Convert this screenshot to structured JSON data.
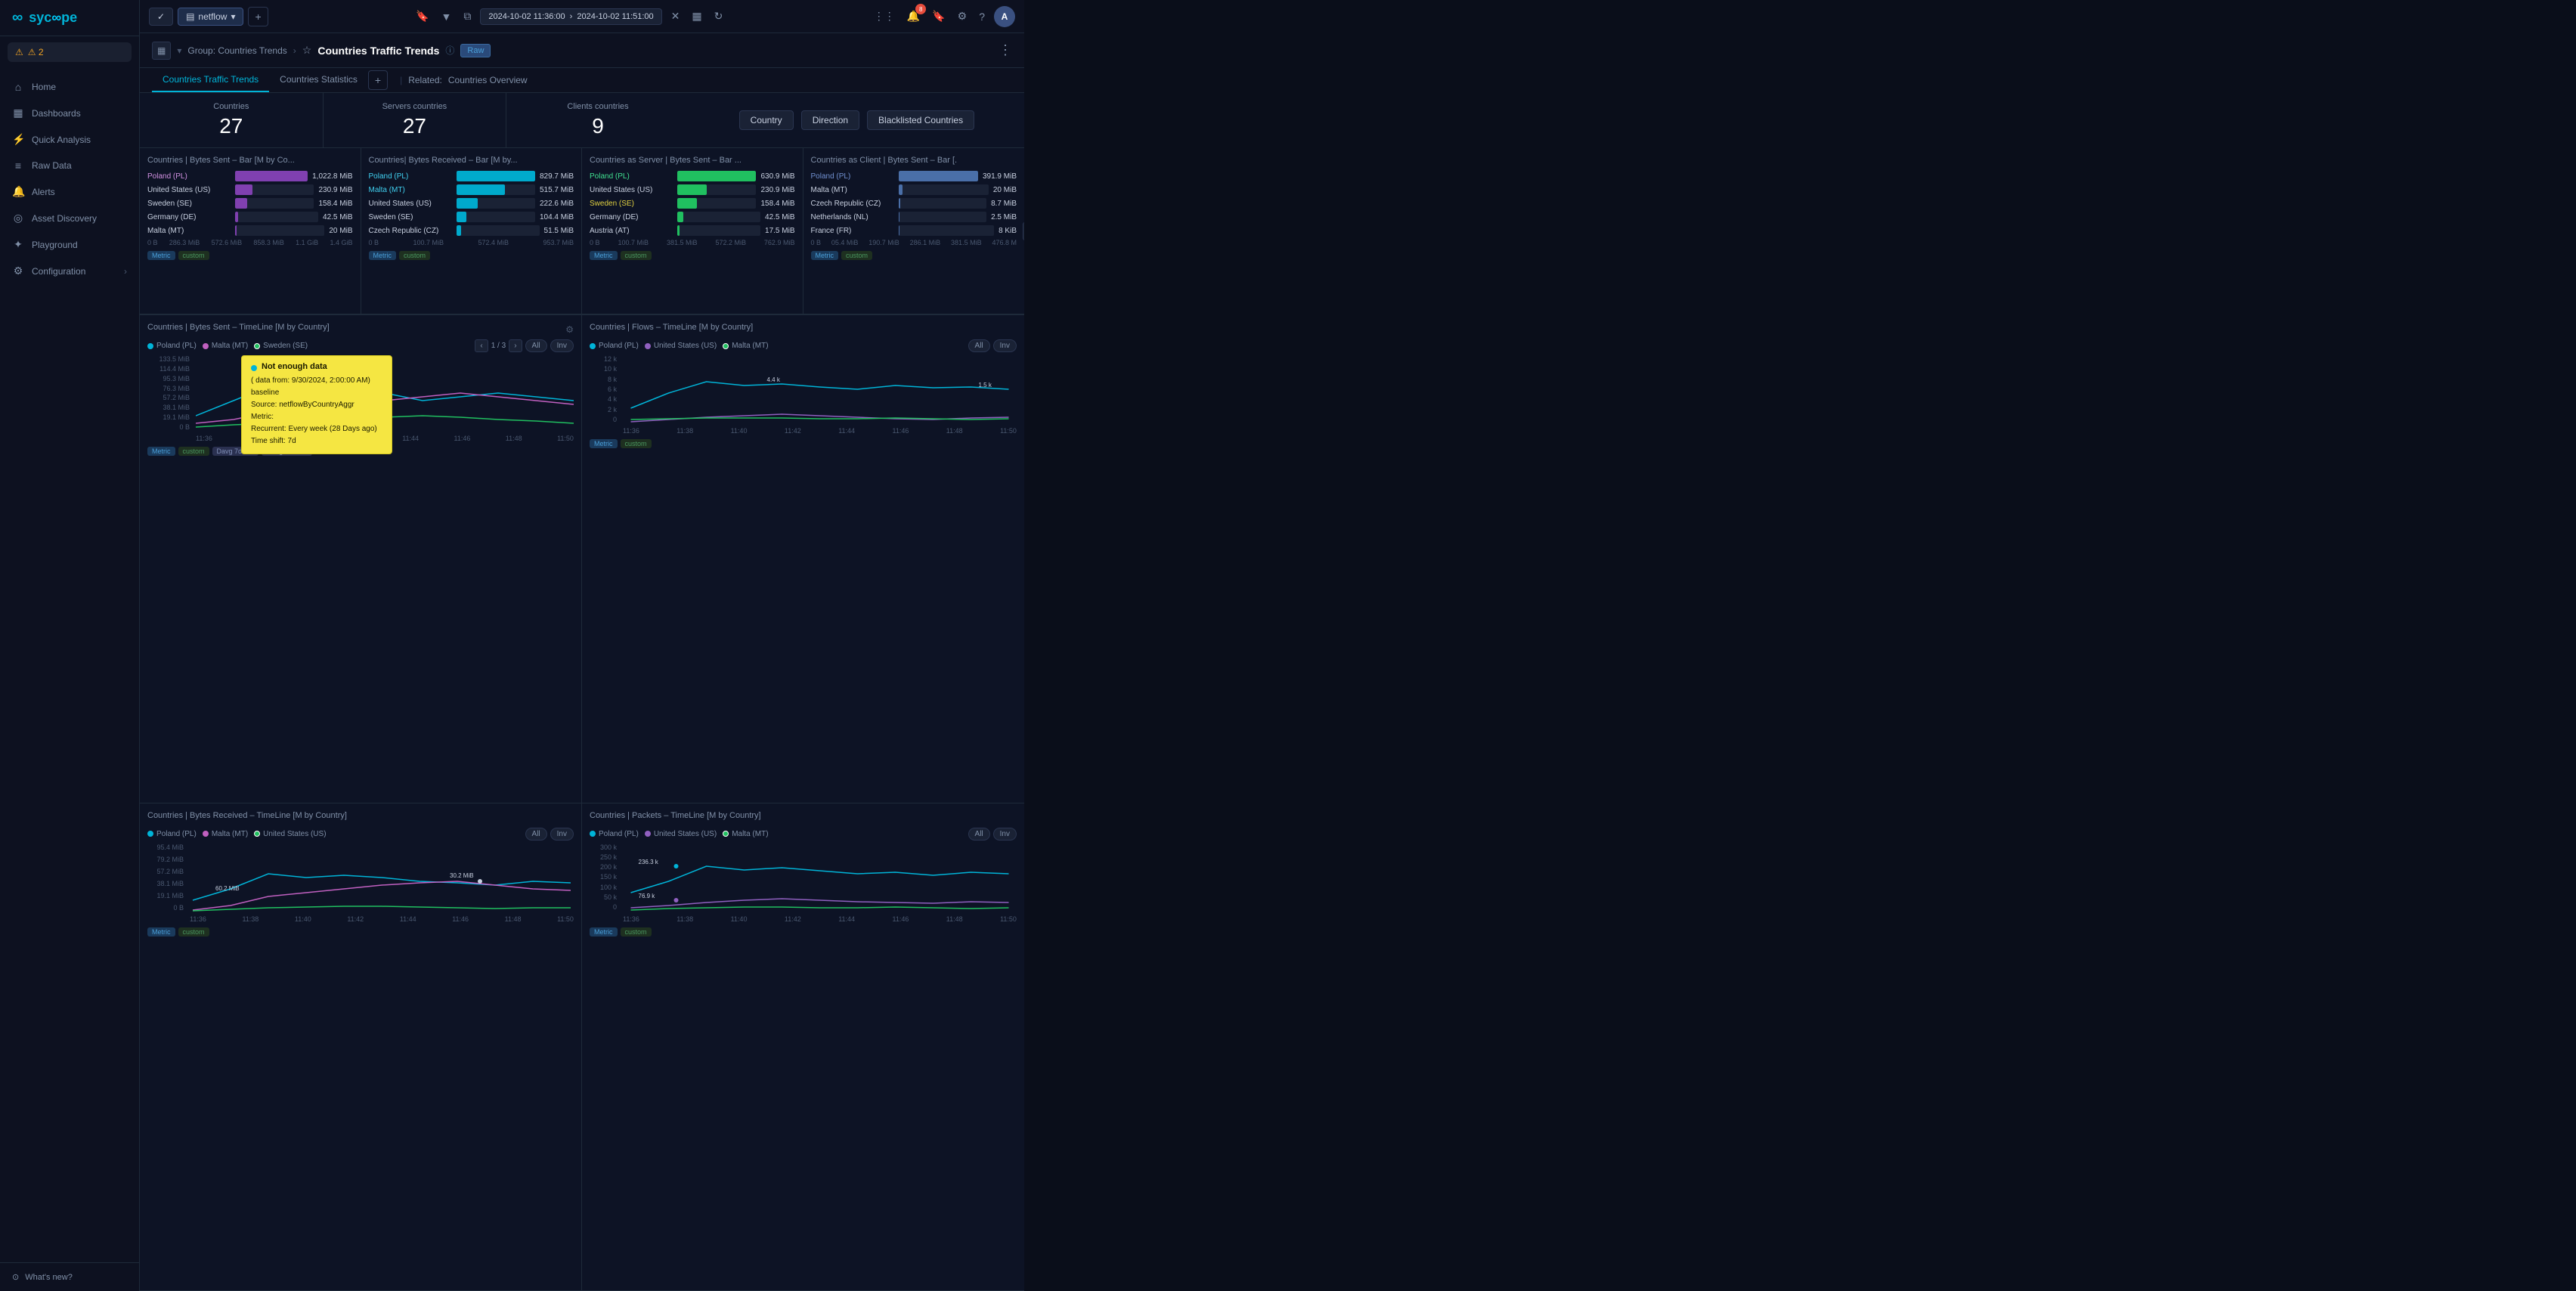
{
  "sidebar": {
    "logo": "syc∞pe",
    "alert": "⚠ 2",
    "items": [
      {
        "id": "home",
        "icon": "⌂",
        "label": "Home",
        "active": false
      },
      {
        "id": "dashboards",
        "icon": "▦",
        "label": "Dashboards",
        "active": false
      },
      {
        "id": "quick-analysis",
        "icon": "⚡",
        "label": "Quick Analysis",
        "active": false
      },
      {
        "id": "raw-data",
        "icon": "≡",
        "label": "Raw Data",
        "active": false
      },
      {
        "id": "alerts",
        "icon": "🔔",
        "label": "Alerts",
        "active": false
      },
      {
        "id": "asset-discovery",
        "icon": "◎",
        "label": "Asset Discovery",
        "active": false
      },
      {
        "id": "playground",
        "icon": "✦",
        "label": "Playground",
        "active": false
      },
      {
        "id": "configuration",
        "icon": "⚙",
        "label": "Configuration",
        "active": false
      }
    ],
    "whats_new": "What's new?"
  },
  "topbar": {
    "tab_label": "netflow",
    "add_tab": "+",
    "time_start": "2024-10-02 11:36:00",
    "time_end": "2024-10-02 11:51:00",
    "notification_count": "8"
  },
  "page_header": {
    "breadcrumb_group": "Group: Countries Trends",
    "page_title": "Countries Traffic Trends",
    "raw_badge": "Raw",
    "related_label": "Related:",
    "related_link": "Countries Overview",
    "tabs": [
      {
        "id": "traffic-trends",
        "label": "Countries Traffic Trends",
        "active": true
      },
      {
        "id": "statistics",
        "label": "Countries Statistics",
        "active": false
      }
    ]
  },
  "stats": {
    "countries": {
      "label": "Countries",
      "value": "27"
    },
    "servers_countries": {
      "label": "Servers countries",
      "value": "27"
    },
    "clients_countries": {
      "label": "Clients countries",
      "value": "9"
    },
    "filters": {
      "country": "Country",
      "direction": "Direction",
      "blacklisted": "Blacklisted Countries"
    }
  },
  "bar_charts": [
    {
      "id": "bytes-sent",
      "title": "Countries | Bytes Sent – Bar [M by Co...",
      "items": [
        {
          "label": "Poland (PL)",
          "value": "1,022.8 MiB",
          "pct": 100,
          "color": "#7c3fa0"
        },
        {
          "label": "United States (US)",
          "value": "230.9 MiB",
          "pct": 22,
          "color": "#7c3fa0"
        },
        {
          "label": "Sweden (SE)",
          "value": "158.4 MiB",
          "pct": 15,
          "color": "#7c3fa0"
        },
        {
          "label": "Germany (DE)",
          "value": "42.5 MiB",
          "pct": 4,
          "color": "#7c3fa0"
        },
        {
          "label": "Malta (MT)",
          "value": "20 MiB",
          "pct": 2,
          "color": "#7c3fa0"
        }
      ],
      "axis": [
        "0 B",
        "286.3 MiB",
        "572.6 MiB",
        "858.3 MiB",
        "1.1 GiB",
        "1.4 GiB"
      ]
    },
    {
      "id": "bytes-received",
      "title": "Countries| Bytes Received – Bar [M by...",
      "items": [
        {
          "label": "Poland (PL)",
          "value": "829.7 MiB",
          "pct": 100,
          "color": "#00aacc"
        },
        {
          "label": "Malta (MT)",
          "value": "515.7 MiB",
          "pct": 62,
          "color": "#00aacc"
        },
        {
          "label": "United States (US)",
          "value": "222.6 MiB",
          "pct": 27,
          "color": "#00aacc"
        },
        {
          "label": "Sweden (SE)",
          "value": "104.4 MiB",
          "pct": 13,
          "color": "#00aacc"
        },
        {
          "label": "Czech Republic (CZ)",
          "value": "51.5 MiB",
          "pct": 6,
          "color": "#00aacc"
        }
      ],
      "axis": [
        "0 B",
        "100.7 MiB",
        "572.4 MiB",
        "953.7 MiB"
      ]
    },
    {
      "id": "as-server-bytes-sent",
      "title": "Countries as Server | Bytes Sent – Bar ...",
      "items": [
        {
          "label": "Poland (PL)",
          "value": "630.9 MiB",
          "pct": 100,
          "color": "#20c060"
        },
        {
          "label": "United States (US)",
          "value": "230.9 MiB",
          "pct": 37,
          "color": "#20c060"
        },
        {
          "label": "Sweden (SE)",
          "value": "158.4 MiB",
          "pct": 25,
          "color": "#20c060"
        },
        {
          "label": "Germany (DE)",
          "value": "42.5 MiB",
          "pct": 7,
          "color": "#20c060"
        },
        {
          "label": "Austria (AT)",
          "value": "17.5 MiB",
          "pct": 3,
          "color": "#20c060"
        }
      ],
      "axis": [
        "0 B",
        "100.7 MiB",
        "381.5 MiB",
        "572.2 MiB",
        "762.9 MiB"
      ]
    },
    {
      "id": "as-client-bytes-sent",
      "title": "Countries as Client | Bytes Sent – Bar [.",
      "items": [
        {
          "label": "Poland (PL)",
          "value": "391.9 MiB",
          "pct": 100,
          "color": "#4a6fa8"
        },
        {
          "label": "Malta (MT)",
          "value": "20 MiB",
          "pct": 5,
          "color": "#4a6fa8"
        },
        {
          "label": "Czech Republic (CZ)",
          "value": "8.7 MiB",
          "pct": 2,
          "color": "#4a6fa8"
        },
        {
          "label": "Netherlands (NL)",
          "value": "2.5 MiB",
          "pct": 1,
          "color": "#4a6fa8"
        },
        {
          "label": "France (FR)",
          "value": "8 KiB",
          "pct": 0.1,
          "color": "#4a6fa8"
        }
      ],
      "axis": [
        "0 B",
        "05.4 MiB",
        "190.7 MiB",
        "286.1 MiB",
        "381.5 MiB",
        "476.8 M"
      ]
    }
  ],
  "timeline_charts": [
    {
      "id": "bytes-sent-timeline",
      "title": "Countries | Bytes Sent – TimeLine [M by Country]",
      "legends": [
        {
          "color": "#00b4d8",
          "label": "Poland (PL)"
        },
        {
          "color": "#c060c0",
          "label": "Malta (MT)"
        },
        {
          "color": "#20c060",
          "label": "Sweden (SE)"
        }
      ],
      "pagination": "1 / 3",
      "pill_all": "All",
      "pill_inv": "Inv",
      "yaxis": [
        "133.5 MiB",
        "114.4 MiB",
        "95.3 MiB",
        "76.3 MiB",
        "57.2 MiB",
        "38.1 MiB",
        "19.1 MiB",
        "0 B"
      ],
      "xaxis": [
        "11:36",
        "11:38",
        "11:40",
        "11:42",
        "11:44",
        "11:46",
        "11:48",
        "11:50"
      ],
      "tags": [
        "Metric",
        "custom",
        "Davg 7d -1d",
        "Wavg 28d -7d"
      ],
      "tooltip": {
        "title": "Not enough data",
        "subtitle": "( data from: 9/30/2024, 2:00:00 AM)",
        "line2": "baseline",
        "source": "Source: netflowByCountryAggr",
        "metric": "Metric:",
        "recurrent": "Recurrent: Every week (28 Days ago)",
        "timeshift": "Time shift: 7d"
      }
    },
    {
      "id": "flows-timeline",
      "title": "Countries | Flows – TimeLine [M by Country]",
      "legends": [
        {
          "color": "#00b4d8",
          "label": "Poland (PL)"
        },
        {
          "color": "#9060c0",
          "label": "United States (US)"
        },
        {
          "color": "#20c060",
          "label": "Malta (MT)"
        }
      ],
      "yaxis": [
        "12 k",
        "10 k",
        "8 k",
        "6 k",
        "4 k",
        "2 k",
        "0"
      ],
      "xaxis": [
        "11:36",
        "11:38",
        "11:40",
        "11:42",
        "11:44",
        "11:46",
        "11:48",
        "11:50"
      ],
      "pill_all": "All",
      "pill_inv": "Inv",
      "annotations": [
        "4.4 k",
        "1.5 k"
      ],
      "tags": [
        "Metric",
        "custom"
      ]
    },
    {
      "id": "bytes-received-timeline",
      "title": "Countries | Bytes Received – TimeLine [M by Country]",
      "legends": [
        {
          "color": "#00b4d8",
          "label": "Poland (PL)"
        },
        {
          "color": "#c060c0",
          "label": "Malta (MT)"
        },
        {
          "color": "#20c060",
          "label": "United States (US)"
        }
      ],
      "pill_all": "All",
      "pill_inv": "Inv",
      "yaxis": [
        "95.4 MiB",
        "79.2 MiB",
        "57.2 MiB",
        "38.1 MiB",
        "19.1 MiB",
        "0 B"
      ],
      "annotations": [
        "30.2 MiB",
        "60.2 MiB"
      ],
      "xaxis": [
        "11:36",
        "11:38",
        "11:40",
        "11:42",
        "11:44",
        "11:46",
        "11:48",
        "11:50"
      ],
      "tags": [
        "Metric",
        "custom"
      ]
    },
    {
      "id": "packets-timeline",
      "title": "Countries | Packets – TimeLine [M by Country]",
      "legends": [
        {
          "color": "#00b4d8",
          "label": "Poland (PL)"
        },
        {
          "color": "#9060c0",
          "label": "United States (US)"
        },
        {
          "color": "#20c060",
          "label": "Malta (MT)"
        }
      ],
      "pill_all": "All",
      "pill_inv": "Inv",
      "yaxis": [
        "300 k",
        "250 k",
        "200 k",
        "150 k",
        "100 k",
        "50 k",
        "0"
      ],
      "annotations": [
        "236.3 k",
        "76.9 k"
      ],
      "xaxis": [
        "11:36",
        "11:38",
        "11:40",
        "11:42",
        "11:44",
        "11:46",
        "11:48",
        "11:50"
      ],
      "tags": [
        "Metric",
        "custom"
      ]
    }
  ],
  "colors": {
    "accent": "#00b4d8",
    "bg_dark": "#0d1120",
    "bg_card": "#0d1325",
    "border": "#1e2a3a",
    "text_muted": "#8090a8",
    "text_main": "#c8d0e0",
    "poland_bar": "#7c3fa0",
    "blue_bar": "#00aacc",
    "green_bar": "#20c060"
  }
}
